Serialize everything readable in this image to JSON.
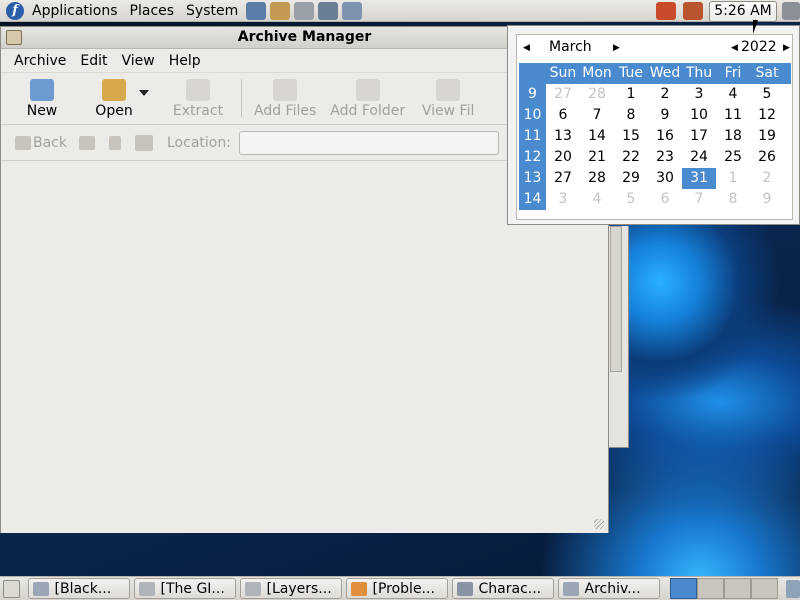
{
  "top_panel": {
    "menus": [
      "Applications",
      "Places",
      "System"
    ],
    "clock": "5:26 AM"
  },
  "window": {
    "title": "Archive Manager",
    "menubar": [
      "Archive",
      "Edit",
      "View",
      "Help"
    ],
    "toolbar": {
      "new_label": "New",
      "open_label": "Open",
      "extract_label": "Extract",
      "add_files_label": "Add Files",
      "add_folder_label": "Add Folder",
      "view_file_label": "View Fil"
    },
    "locationbar": {
      "back_label": "Back",
      "location_label": "Location:"
    }
  },
  "calendar": {
    "month": "March",
    "year": "2022",
    "days_of_week": [
      "Sun",
      "Mon",
      "Tue",
      "Wed",
      "Thu",
      "Fri",
      "Sat"
    ],
    "weeks": [
      {
        "week": "9",
        "days": [
          "27",
          "28",
          "1",
          "2",
          "3",
          "4",
          "5"
        ]
      },
      {
        "week": "10",
        "days": [
          "6",
          "7",
          "8",
          "9",
          "10",
          "11",
          "12"
        ]
      },
      {
        "week": "11",
        "days": [
          "13",
          "14",
          "15",
          "16",
          "17",
          "18",
          "19"
        ]
      },
      {
        "week": "12",
        "days": [
          "20",
          "21",
          "22",
          "23",
          "24",
          "25",
          "26"
        ]
      },
      {
        "week": "13",
        "days": [
          "27",
          "28",
          "29",
          "30",
          "31",
          "1",
          "2"
        ]
      },
      {
        "week": "14",
        "days": [
          "3",
          "4",
          "5",
          "6",
          "7",
          "8",
          "9"
        ]
      }
    ],
    "selected_day": "31"
  },
  "taskbar": {
    "tasks": [
      "[Black...",
      "[The GI...",
      "[Layers...",
      "[Proble...",
      "Charac...",
      "Archiv..."
    ]
  },
  "colors": {
    "selection": "#4a8bd0",
    "panel": "#e9e7e3"
  }
}
